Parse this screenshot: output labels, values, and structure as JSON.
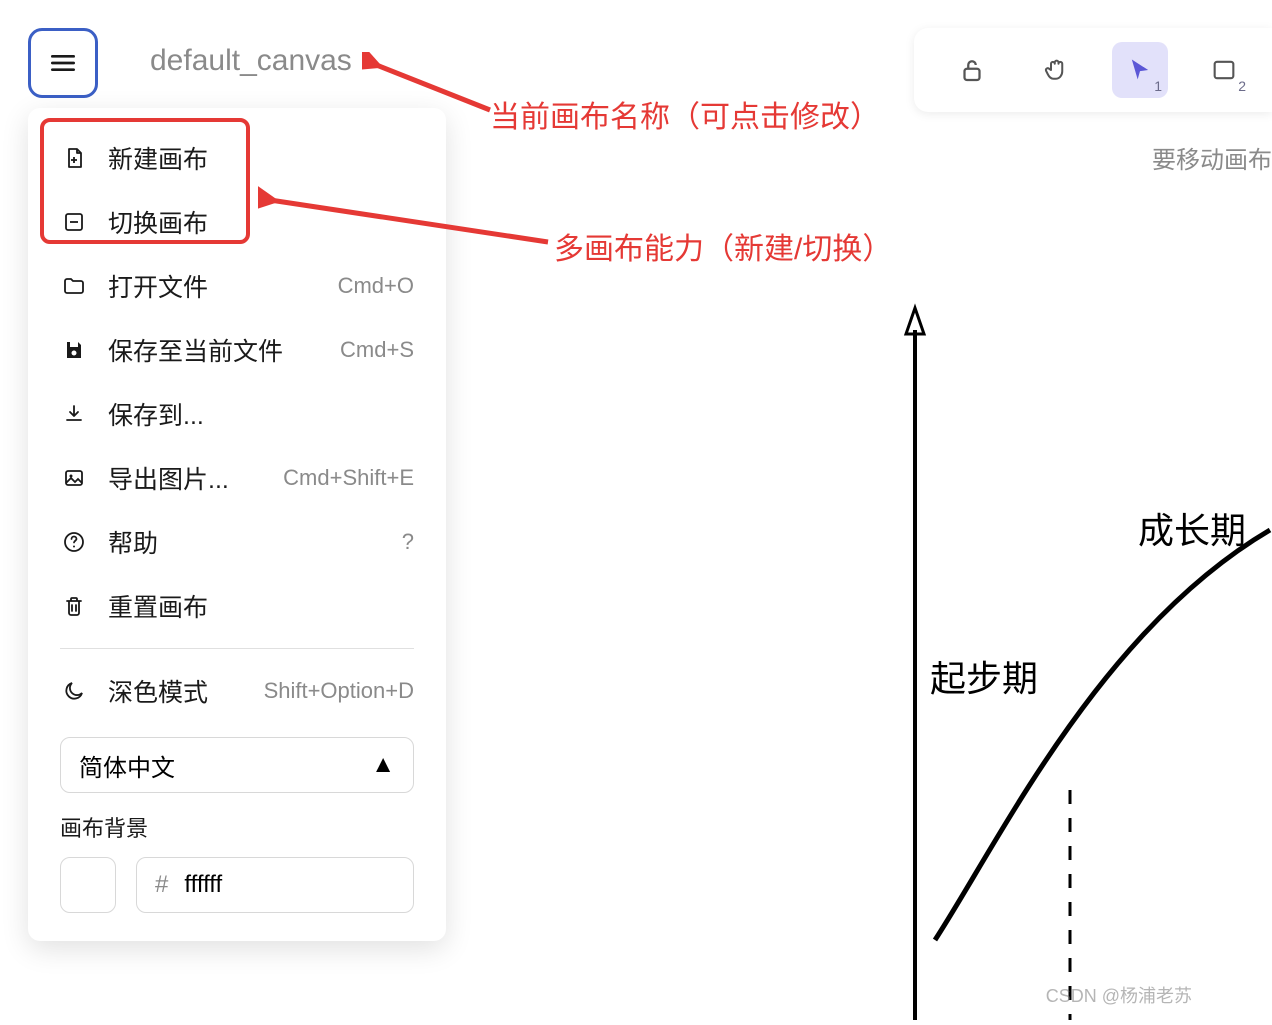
{
  "header": {
    "canvas_name": "default_canvas"
  },
  "toolbar": {
    "lock_badge": "",
    "hand_badge": "",
    "pointer_badge": "1",
    "rect_badge": "2",
    "move_hint": "要移动画布"
  },
  "annotations": {
    "canvas_name": "当前画布名称（可点击修改）",
    "multi_canvas": "多画布能力（新建/切换）"
  },
  "menu": {
    "new_canvas": "新建画布",
    "switch_canvas": "切换画布",
    "open_file": {
      "label": "打开文件",
      "shortcut": "Cmd+O"
    },
    "save_current": {
      "label": "保存至当前文件",
      "shortcut": "Cmd+S"
    },
    "save_to": "保存到...",
    "export_image": {
      "label": "导出图片...",
      "shortcut": "Cmd+Shift+E"
    },
    "help": {
      "label": "帮助",
      "shortcut": "?"
    },
    "reset_canvas": "重置画布",
    "dark_mode": {
      "label": "深色模式",
      "shortcut": "Shift+Option+D"
    },
    "language": "简体中文",
    "canvas_bg_label": "画布背景",
    "bg_hex_prefix": "#",
    "bg_hex_value": "ffffff"
  },
  "canvas": {
    "label_growth": "成长期",
    "label_start": "起步期"
  },
  "watermark": "CSDN @杨浦老苏"
}
